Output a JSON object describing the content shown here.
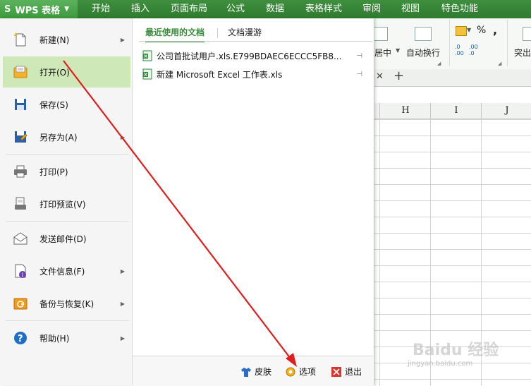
{
  "app_button": {
    "logo": "S",
    "label": "WPS 表格",
    "caret": "▼"
  },
  "ribbon_tabs": [
    "开始",
    "插入",
    "页面布局",
    "公式",
    "数据",
    "表格样式",
    "审阅",
    "视图",
    "特色功能"
  ],
  "ribbon": {
    "merge_label": "居中",
    "wrap_label": "自动换行",
    "highlight_label": "突出",
    "percent": "%",
    "comma": ",",
    "inc_decimal": ".0\n.00",
    "dec_decimal": ".00\n.0"
  },
  "sheet_tabs": {
    "close": "✕",
    "add": "+"
  },
  "columns": [
    "H",
    "I",
    "J"
  ],
  "menu": {
    "items": [
      {
        "label": "新建(N)",
        "icon": "new-doc-icon",
        "has_submenu": true
      },
      {
        "label": "打开(O)",
        "icon": "open-folder-icon",
        "has_submenu": false,
        "selected": true
      },
      {
        "label": "保存(S)",
        "icon": "save-icon",
        "has_submenu": false
      },
      {
        "label": "另存为(A)",
        "icon": "save-as-icon",
        "has_submenu": true
      },
      {
        "label": "打印(P)",
        "icon": "print-icon",
        "has_submenu": false
      },
      {
        "label": "打印预览(V)",
        "icon": "print-preview-icon",
        "has_submenu": false
      },
      {
        "label": "发送邮件(D)",
        "icon": "mail-icon",
        "has_submenu": false
      },
      {
        "label": "文件信息(F)",
        "icon": "file-info-icon",
        "has_submenu": true
      },
      {
        "label": "备份与恢复(K)",
        "icon": "backup-restore-icon",
        "has_submenu": true
      },
      {
        "label": "帮助(H)",
        "icon": "help-icon",
        "has_submenu": true
      }
    ]
  },
  "recent": {
    "tabs": [
      "最近使用的文档",
      "文档漫游"
    ],
    "docs": [
      {
        "name": "公司首批试用户.xls.E799BDAEC6ECCC5FB8..."
      },
      {
        "name": "新建 Microsoft Excel 工作表.xls"
      }
    ]
  },
  "bottom": {
    "skin": "皮肤",
    "options": "选项",
    "exit": "退出"
  },
  "watermark": {
    "main": "Baidu 经验",
    "sub": "jingyan.baidu.com"
  },
  "colors": {
    "ribbon_green": "#3f8f3f",
    "selected_item": "#cfe8b8",
    "accent_green": "#3b8a3b",
    "arrow_red": "#e01e1e"
  }
}
